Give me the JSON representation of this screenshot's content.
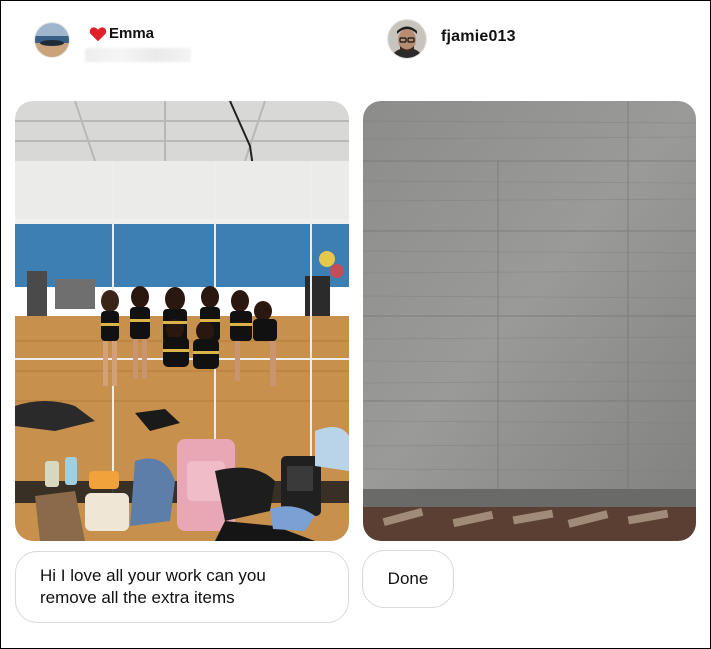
{
  "left_post": {
    "username": "Emma",
    "heart_icon": "red-heart-icon",
    "avatar_icon": "beach-avatar",
    "photo_desc_icon": "gym-mirror-photo",
    "message": "Hi I love all your work can you remove all the extra items"
  },
  "right_post": {
    "username": "fjamie013",
    "avatar_icon": "man-with-glasses-avatar",
    "photo_desc_icon": "concrete-wall-photo",
    "message": "Done"
  },
  "colors": {
    "heart": "#e0202b",
    "bubble_border": "#d9d9d9"
  }
}
